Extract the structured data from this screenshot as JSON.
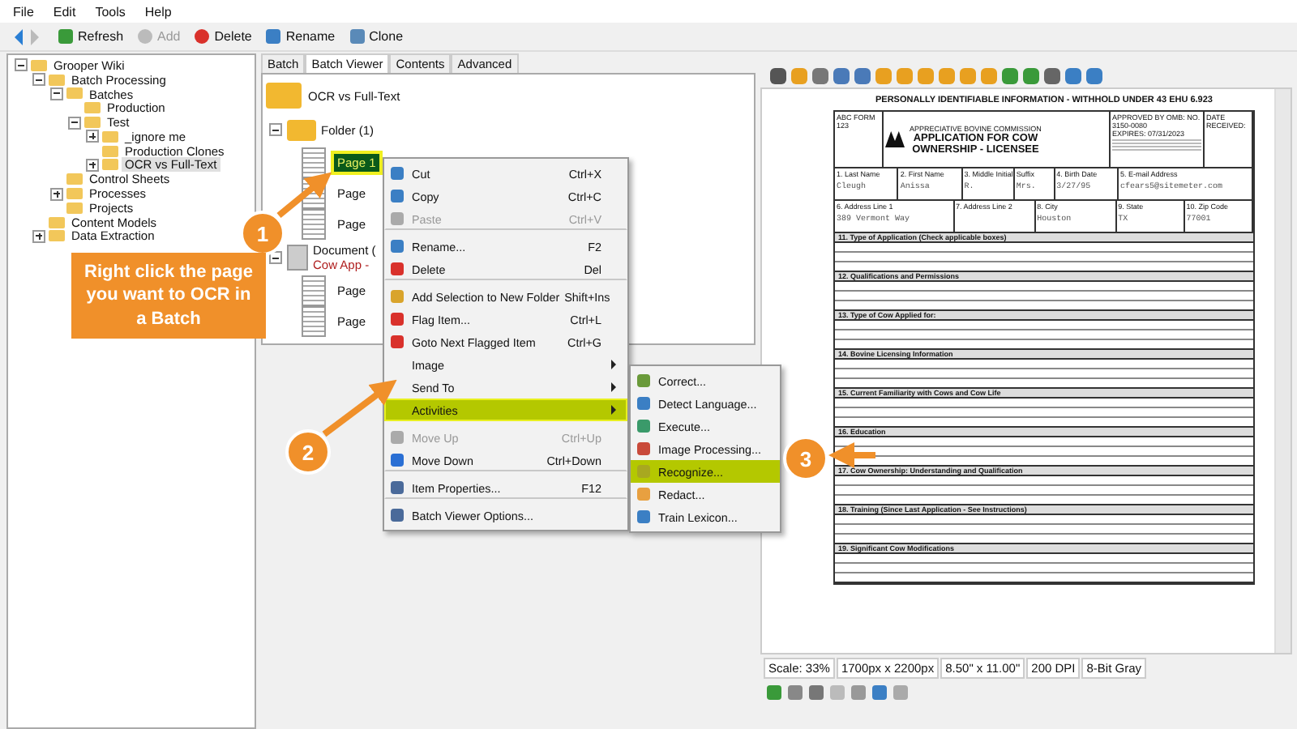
{
  "menu_bar": [
    "File",
    "Edit",
    "Tools",
    "Help"
  ],
  "toolbar": [
    {
      "kind": "back",
      "disabled": false
    },
    {
      "kind": "forward",
      "disabled": true
    },
    {
      "kind": "refresh",
      "label": "Refresh",
      "disabled": false
    },
    {
      "kind": "add",
      "label": "Add",
      "disabled": true
    },
    {
      "kind": "delete",
      "label": "Delete",
      "disabled": false
    },
    {
      "kind": "rename",
      "label": "Rename",
      "disabled": false
    },
    {
      "kind": "clone",
      "label": "Clone",
      "disabled": false
    }
  ],
  "tree": [
    {
      "label": "Grooper Wiki",
      "expanded": true,
      "selected": false,
      "children": [
        {
          "label": "Batch Processing",
          "expanded": true,
          "selected": false,
          "children": [
            {
              "label": "Batches",
              "expanded": true,
              "selected": false,
              "children": [
                {
                  "label": "Production",
                  "selected": false
                },
                {
                  "label": "Test",
                  "expanded": true,
                  "selected": false,
                  "children": [
                    {
                      "label": "_ignore me",
                      "expanded": false,
                      "selected": false
                    },
                    {
                      "label": "Production Clones",
                      "selected": false
                    },
                    {
                      "label": "OCR vs Full-Text",
                      "expanded": false,
                      "selected": true
                    }
                  ]
                }
              ]
            },
            {
              "label": "Control Sheets",
              "selected": false
            },
            {
              "label": "Processes",
              "expanded": false,
              "selected": false
            },
            {
              "label": "Projects",
              "selected": false
            }
          ]
        },
        {
          "label": "Content Models",
          "selected": false
        },
        {
          "label": "Data Extraction",
          "expanded": false,
          "selected": false
        }
      ]
    }
  ],
  "tabs": [
    {
      "label": "Batch",
      "selected": false
    },
    {
      "label": "Batch Viewer",
      "selected": true
    },
    {
      "label": "Contents",
      "selected": false
    },
    {
      "label": "Advanced",
      "selected": false
    }
  ],
  "batch_viewer": {
    "root": "OCR vs Full-Text",
    "items": [
      {
        "kind": "folder",
        "label": "Folder (1)",
        "children": [
          {
            "label": "Page 1",
            "selected": true
          },
          {
            "label": "Page",
            "selected": false
          },
          {
            "label": "Page",
            "selected": false
          }
        ]
      },
      {
        "kind": "document",
        "label": "Document (",
        "sublabel": "Cow App - ",
        "children": [
          {
            "label": "Page",
            "selected": false
          },
          {
            "label": "Page",
            "selected": false
          }
        ]
      }
    ]
  },
  "context_menu": [
    {
      "label": "Cut",
      "shortcut": "Ctrl+X",
      "disabled": false,
      "submenu": false,
      "selected": false,
      "separator_after": false
    },
    {
      "label": "Copy",
      "shortcut": "Ctrl+C",
      "disabled": false,
      "submenu": false,
      "selected": false,
      "separator_after": false
    },
    {
      "label": "Paste",
      "shortcut": "Ctrl+V",
      "disabled": true,
      "submenu": false,
      "selected": false,
      "separator_after": true
    },
    {
      "label": "Rename...",
      "shortcut": "F2",
      "disabled": false,
      "submenu": false,
      "selected": false,
      "separator_after": false
    },
    {
      "label": "Delete",
      "shortcut": "Del",
      "disabled": false,
      "submenu": false,
      "selected": false,
      "separator_after": true
    },
    {
      "label": "Add Selection to New Folder",
      "shortcut": "Shift+Ins",
      "disabled": false,
      "submenu": false,
      "selected": false,
      "separator_after": false
    },
    {
      "label": "Flag Item...",
      "shortcut": "Ctrl+L",
      "disabled": false,
      "submenu": false,
      "selected": false,
      "separator_after": false
    },
    {
      "label": "Goto Next Flagged Item",
      "shortcut": "Ctrl+G",
      "disabled": false,
      "submenu": false,
      "selected": false,
      "separator_after": false
    },
    {
      "label": "Image",
      "disabled": false,
      "submenu": true,
      "selected": false,
      "separator_after": false
    },
    {
      "label": "Send To",
      "disabled": false,
      "submenu": true,
      "selected": false,
      "separator_after": false
    },
    {
      "label": "Activities",
      "disabled": false,
      "submenu": true,
      "selected": true,
      "separator_after": true
    },
    {
      "label": "Move Up",
      "shortcut": "Ctrl+Up",
      "disabled": true,
      "submenu": false,
      "selected": false,
      "separator_after": false
    },
    {
      "label": "Move Down",
      "shortcut": "Ctrl+Down",
      "disabled": false,
      "submenu": false,
      "selected": false,
      "separator_after": true
    },
    {
      "label": "Item Properties...",
      "shortcut": "F12",
      "disabled": false,
      "submenu": false,
      "selected": false,
      "separator_after": true
    },
    {
      "label": "Batch Viewer Options...",
      "disabled": false,
      "submenu": false,
      "selected": false,
      "separator_after": false
    }
  ],
  "activities_submenu": [
    {
      "label": "Correct...",
      "selected": false
    },
    {
      "label": "Detect Language...",
      "selected": false
    },
    {
      "label": "Execute...",
      "selected": false
    },
    {
      "label": "Image Processing...",
      "selected": false
    },
    {
      "label": "Recognize...",
      "selected": true
    },
    {
      "label": "Redact...",
      "selected": false
    },
    {
      "label": "Train Lexicon...",
      "selected": false
    }
  ],
  "document": {
    "banner": "PERSONALLY IDENTIFIABLE INFORMATION - WITHHOLD UNDER 43 EHU 6.923",
    "form_id": "ABC FORM 123",
    "agency": "APPRECIATIVE BOVINE COMMISSION",
    "title": "APPLICATION FOR COW OWNERSHIP - LICENSEE",
    "approval": "APPROVED BY OMB:  NO. 3150-0080",
    "expires": "EXPIRES: 07/31/2023",
    "date_received": "DATE RECEIVED:",
    "fields": [
      [
        {
          "label": "1. Last Name",
          "value": "Cleugh"
        },
        {
          "label": "2. First Name",
          "value": "Anissa"
        },
        {
          "label": "3. Middle Initial",
          "value": "R."
        },
        {
          "label": "Suffix",
          "value": "Mrs."
        },
        {
          "label": "4. Birth Date",
          "value": "3/27/95"
        },
        {
          "label": "5. E-mail Address",
          "value": "cfears5@sitemeter.com"
        }
      ],
      [
        {
          "label": "6. Address Line 1",
          "value": "389 Vermont Way"
        },
        {
          "label": "7. Address Line 2"
        },
        {
          "label": "8. City",
          "value": "Houston"
        },
        {
          "label": "9. State",
          "value": "TX"
        },
        {
          "label": "10. Zip Code",
          "value": "77001"
        }
      ]
    ],
    "sections": [
      "11. Type of Application (Check applicable boxes)",
      "12. Qualifications and Permissions",
      "13. Type of Cow Applied for:",
      "14. Bovine Licensing Information",
      "15. Current Familiarity with Cows and Cow Life",
      "16. Education",
      "17. Cow Ownership: Understanding and Qualification",
      "18. Training (Since Last Application - See Instructions)",
      "19. Significant Cow Modifications"
    ]
  },
  "status_bar": [
    "Scale: 33%",
    "1700px x 2200px",
    "8.50\" x 11.00\"",
    "200 DPI",
    "8-Bit Gray"
  ],
  "callouts": [
    {
      "number": "1",
      "text": "Right click the page you want to OCR in a Batch"
    },
    {
      "number": "2"
    },
    {
      "number": "3"
    }
  ]
}
